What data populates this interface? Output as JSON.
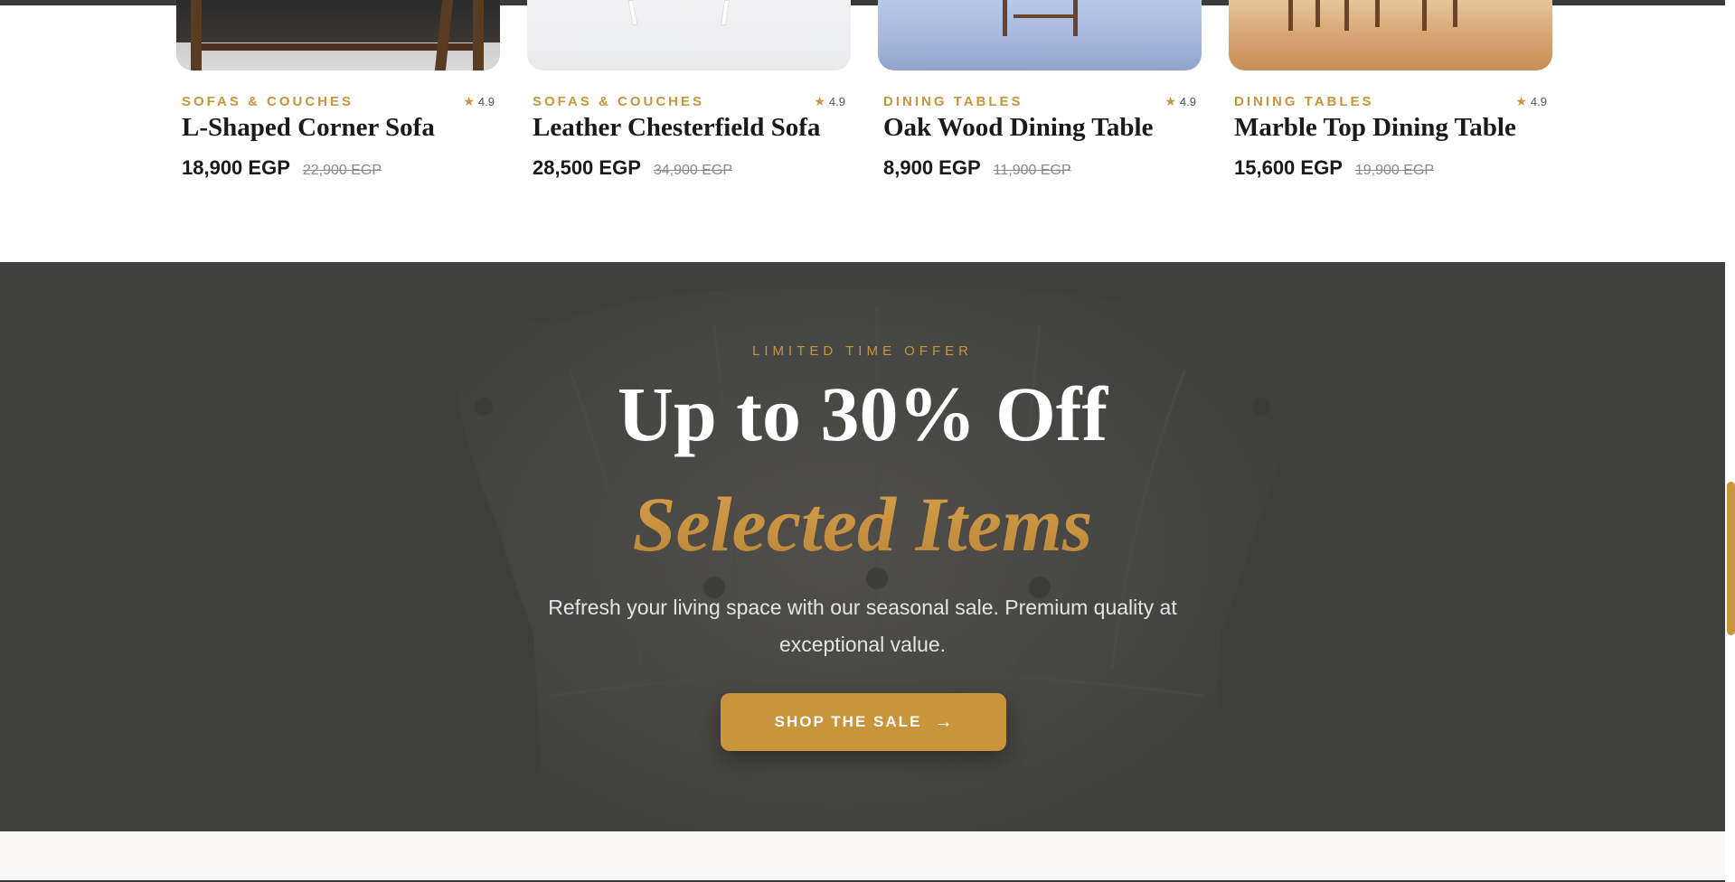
{
  "products": [
    {
      "category": "SOFAS & COUCHES",
      "rating": "4.9",
      "title": "L-Shaped Corner Sofa",
      "price": "18,900 EGP",
      "old_price": "22,900 EGP",
      "image_icon": "sofa-product-image"
    },
    {
      "category": "SOFAS & COUCHES",
      "rating": "4.9",
      "title": "Leather Chesterfield Sofa",
      "price": "28,500 EGP",
      "old_price": "34,900 EGP",
      "image_icon": "sofa-product-image"
    },
    {
      "category": "DINING TABLES",
      "rating": "4.9",
      "title": "Oak Wood Dining Table",
      "price": "8,900 EGP",
      "old_price": "11,900 EGP",
      "image_icon": "dining-table-product-image"
    },
    {
      "category": "DINING TABLES",
      "rating": "4.9",
      "title": "Marble Top Dining Table",
      "price": "15,600 EGP",
      "old_price": "19,900 EGP",
      "image_icon": "dining-table-product-image"
    }
  ],
  "banner": {
    "eyebrow": "LIMITED TIME OFFER",
    "title": "Up to 30% Off",
    "subtitle": "Selected Items",
    "description": "Refresh your living space with our seasonal sale. Premium quality at exceptional value.",
    "button_label": "SHOP THE SALE",
    "button_icon": "arrow-right-icon"
  },
  "colors": {
    "accent": "#c8943c",
    "banner_bg": "#3f403e",
    "text_dark": "#1a1a1a"
  }
}
